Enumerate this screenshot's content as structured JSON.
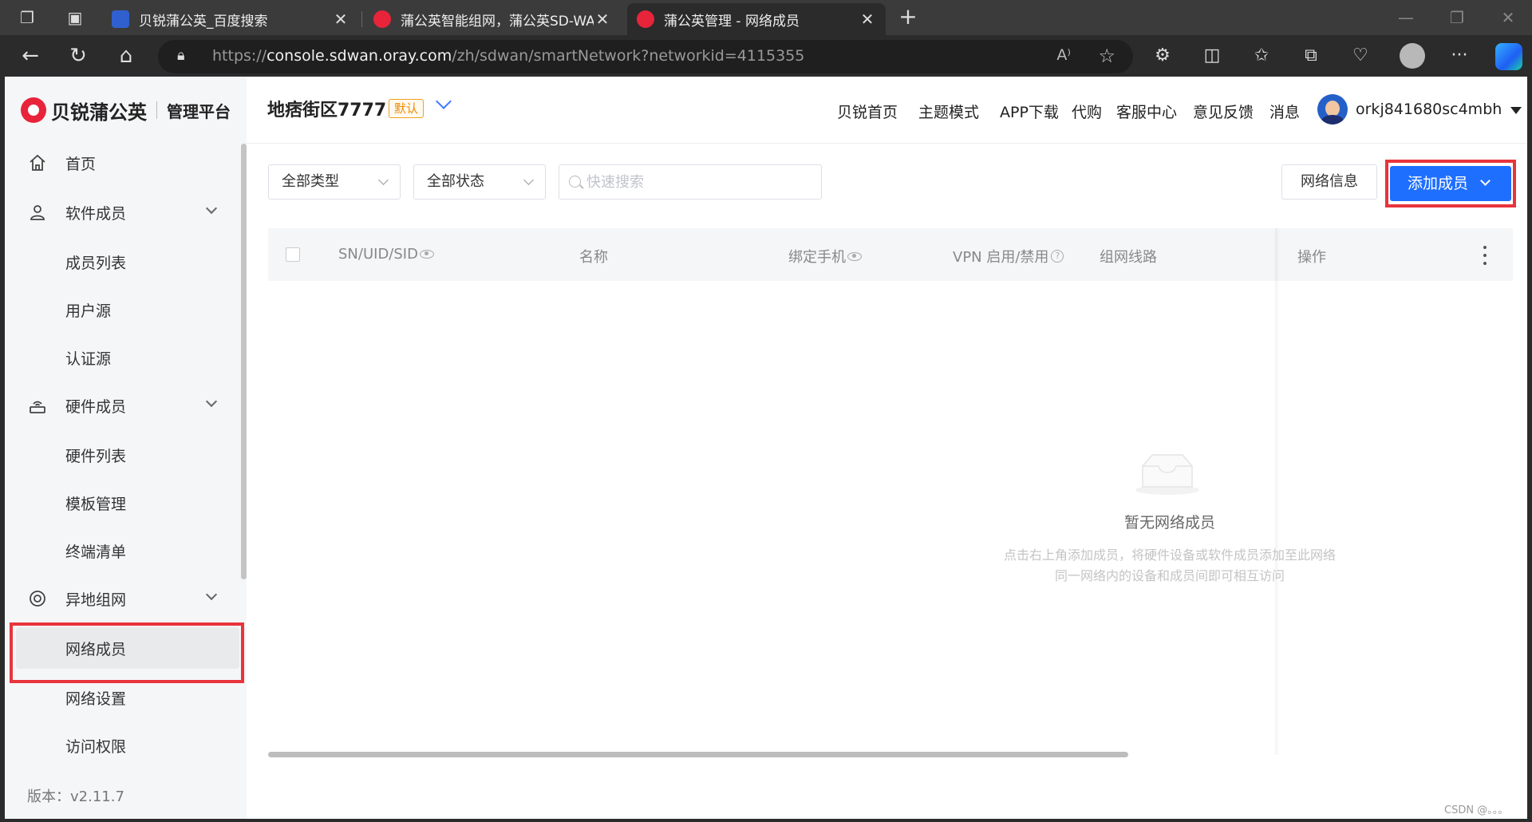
{
  "browser": {
    "tabs": [
      {
        "title": "贝锐蒲公英_百度搜索",
        "favicon_color": "#3060d0"
      },
      {
        "title": "蒲公英智能组网，蒲公英SD-WAN",
        "favicon_color": "#e8243a"
      },
      {
        "title": "蒲公英管理 - 网络成员",
        "favicon_color": "#e8243a"
      }
    ],
    "url_prefix": "https://",
    "url_host": "console.sdwan.oray.com",
    "url_path": "/zh/sdwan/smartNetwork?networkid=4115355"
  },
  "sidebar": {
    "brand": "贝锐蒲公英",
    "platform": "管理平台",
    "items": {
      "home": "首页",
      "software_members": "软件成员",
      "member_list": "成员列表",
      "user_source": "用户源",
      "auth_source": "认证源",
      "hardware_members": "硬件成员",
      "hardware_list": "硬件列表",
      "template_mgmt": "模板管理",
      "terminal_list": "终端清单",
      "remote_network": "异地组网",
      "network_members": "网络成员",
      "network_settings": "网络设置",
      "access_rights": "访问权限"
    },
    "version": "版本：v2.11.7"
  },
  "header": {
    "network_name": "地痞街区7777",
    "default_badge": "默认",
    "nav": [
      "贝锐首页",
      "主题模式",
      "APP下载",
      "代购",
      "客服中心",
      "意见反馈",
      "消息"
    ],
    "username": "orkj841680sc4mbh"
  },
  "filters": {
    "type_select": "全部类型",
    "status_select": "全部状态",
    "search_placeholder": "快速搜索",
    "network_info_button": "网络信息",
    "add_member_button": "添加成员"
  },
  "table": {
    "columns": [
      "SN/UID/SID",
      "名称",
      "绑定手机",
      "VPN 启用/禁用",
      "组网线路",
      "操作"
    ],
    "empty_title": "暂无网络成员",
    "empty_desc_1": "点击右上角添加成员，将硬件设备或软件成员添加至此网络",
    "empty_desc_2": "同一网络内的设备和成员间即可相互访问"
  },
  "watermark": "CSDN @。。。",
  "colors": {
    "accent": "#1f6fff",
    "highlight_box": "#e8343c",
    "brand": "#e8243a"
  }
}
